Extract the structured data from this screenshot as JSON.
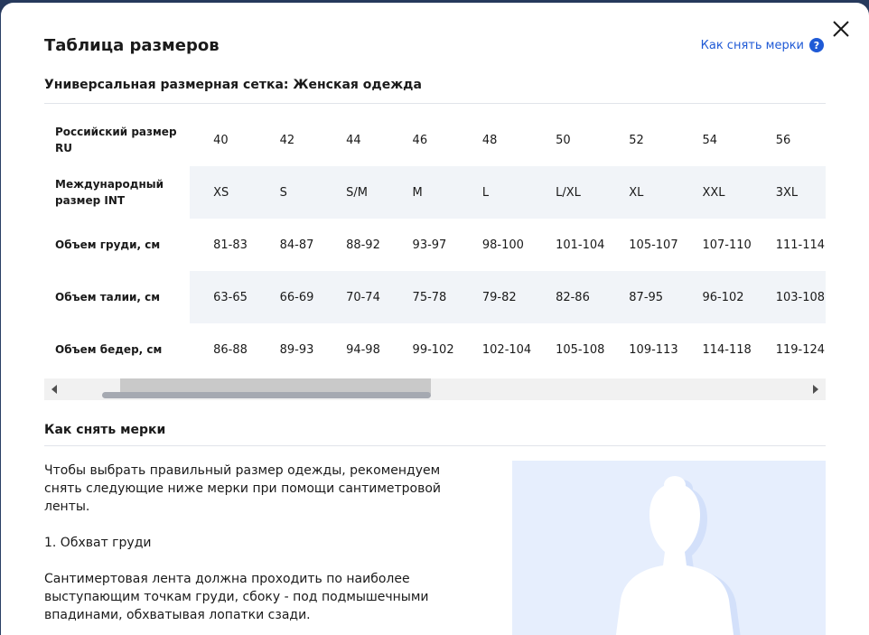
{
  "modal": {
    "title": "Таблица размеров",
    "measure_link": "Как снять мерки",
    "help_glyph": "?",
    "subtitle": "Универсальная размерная сетка: Женская одежда"
  },
  "table": {
    "rows": [
      {
        "label": "Российский размер RU",
        "values": [
          "40",
          "42",
          "44",
          "46",
          "48",
          "50",
          "52",
          "54",
          "56"
        ]
      },
      {
        "label": "Международный размер INT",
        "values": [
          "XS",
          "S",
          "S/M",
          "M",
          "L",
          "L/XL",
          "XL",
          "XXL",
          "3XL"
        ]
      },
      {
        "label": "Объем груди, см",
        "values": [
          "81-83",
          "84-87",
          "88-92",
          "93-97",
          "98-100",
          "101-104",
          "105-107",
          "107-110",
          "111-114"
        ]
      },
      {
        "label": "Объем талии, см",
        "values": [
          "63-65",
          "66-69",
          "70-74",
          "75-78",
          "79-82",
          "82-86",
          "87-95",
          "96-102",
          "103-108"
        ]
      },
      {
        "label": "Объем бедер, см",
        "values": [
          "86-88",
          "89-93",
          "94-98",
          "99-102",
          "102-104",
          "105-108",
          "109-113",
          "114-118",
          "119-124"
        ]
      }
    ]
  },
  "howto": {
    "title": "Как снять мерки",
    "intro": "Чтобы выбрать правильный размер одежды, рекомендуем снять следующие ниже мерки при помощи сантиметровой ленты.",
    "step1_title": "1. Обхват груди",
    "step1_text": "Сантимертовая лента должна проходить по наиболее выступающим точкам груди, сбоку - под подмышечными впадинами, обхватывая лопатки сзади."
  },
  "colors": {
    "accent": "#1f5ad6",
    "figure_bg": "#e6eefd",
    "row_alt": "#f1f4f8"
  },
  "icons": [
    "close-icon",
    "help-icon",
    "scroll-left-icon",
    "scroll-right-icon"
  ]
}
